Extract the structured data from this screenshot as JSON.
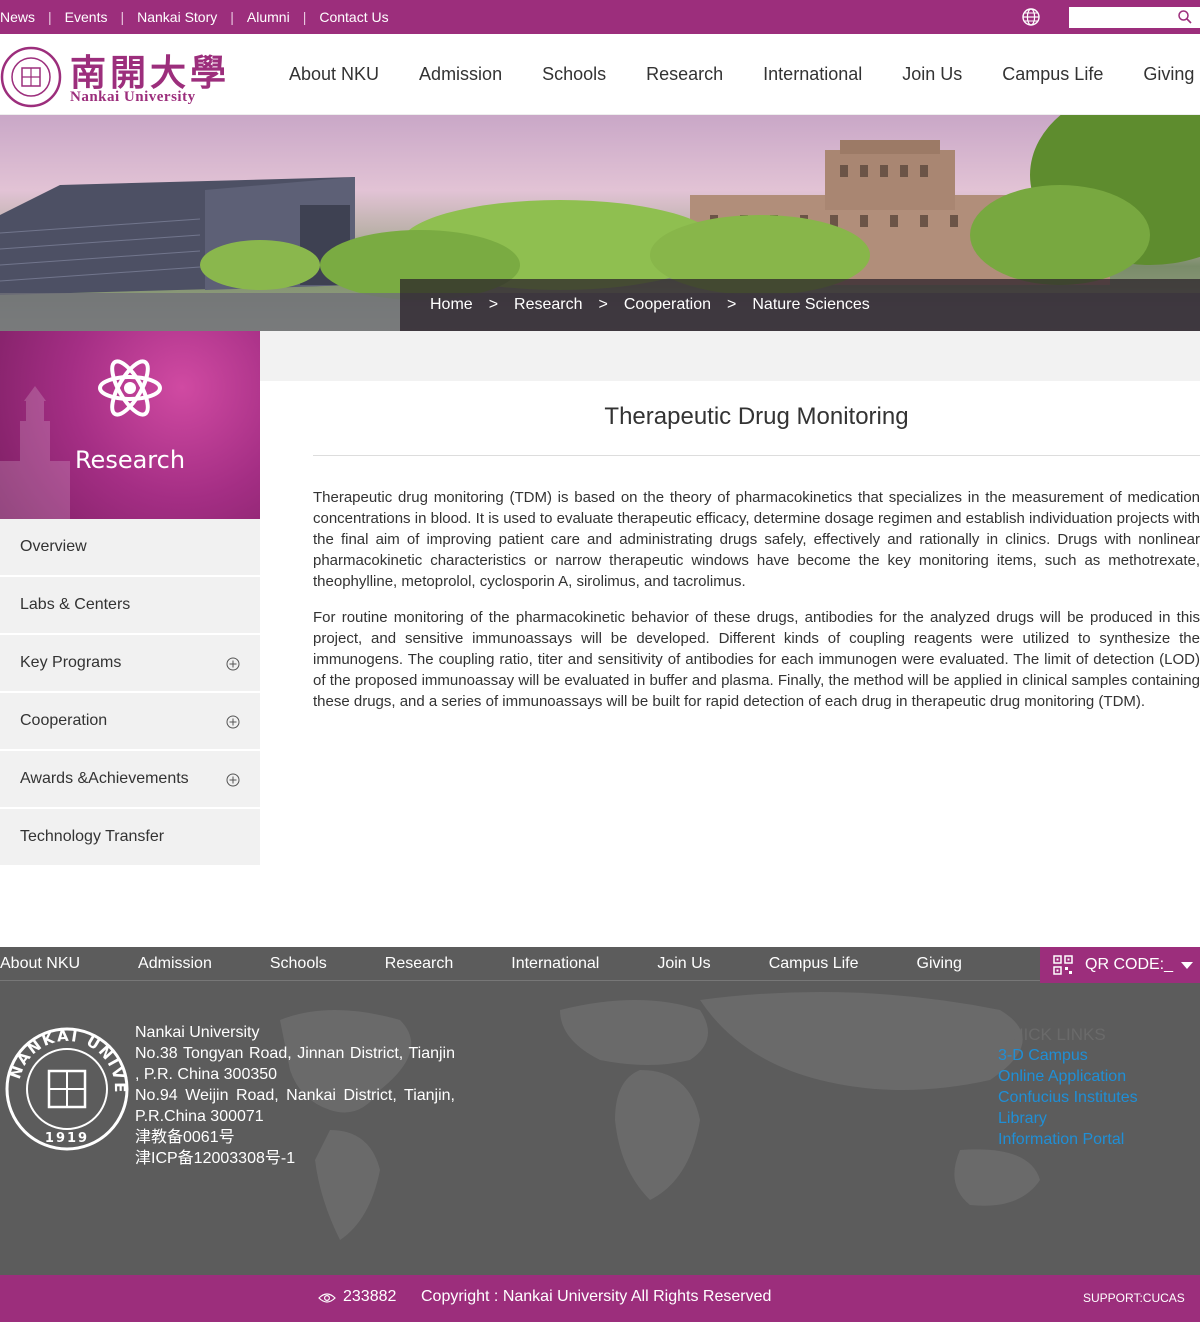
{
  "topbar": {
    "links": [
      "News",
      "Events",
      "Nankai Story",
      "Alumni",
      "Contact Us"
    ],
    "search_placeholder": ""
  },
  "header": {
    "logo_cn": "南開大學",
    "logo_en": "Nankai University",
    "nav": [
      "About NKU",
      "Admission",
      "Schools",
      "Research",
      "International",
      "Join Us",
      "Campus Life",
      "Giving"
    ]
  },
  "breadcrumb": {
    "items": [
      "Home",
      "Research",
      "Cooperation",
      "Nature Sciences"
    ],
    "separator": ">"
  },
  "sidebar": {
    "title": "Research",
    "items": [
      {
        "label": "Overview",
        "expandable": false
      },
      {
        "label": "Labs & Centers",
        "expandable": false
      },
      {
        "label": "Key Programs",
        "expandable": true
      },
      {
        "label": "Cooperation",
        "expandable": true
      },
      {
        "label": "Awards &Achievements",
        "expandable": true
      },
      {
        "label": "Technology Transfer",
        "expandable": false
      }
    ]
  },
  "article": {
    "title": "Therapeutic Drug Monitoring",
    "paragraphs": [
      "Therapeutic drug monitoring (TDM) is based on the theory of pharmacokinetics that specializes in the measurement of medication concentrations in blood. It is used to evaluate therapeutic efficacy, determine dosage regimen and establish individuation projects with the final aim of improving patient care and administrating drugs safely, effectively and rationally in clinics. Drugs with nonlinear pharmacokinetic characteristics or narrow therapeutic windows have become the key monitoring items, such as methotrexate, theophylline, metoprolol, cyclosporin A, sirolimus, and tacrolimus.",
      "For routine monitoring of the pharmacokinetic behavior of these drugs, antibodies for the analyzed drugs will be produced in this project, and sensitive immunoassays will be developed. Different kinds of coupling reagents were utilized to synthesize the immunogens. The coupling ratio, titer and sensitivity of antibodies for each immunogen were evaluated. The limit of detection (LOD) of the proposed immunoassay will be evaluated in buffer and plasma. Finally, the method will be applied in clinical samples containing these drugs, and a series of immunoassays will be built for rapid detection of each drug in therapeutic drug monitoring (TDM)."
    ]
  },
  "footer": {
    "nav": [
      "About NKU",
      "Admission",
      "Schools",
      "Research",
      "International",
      "Join Us",
      "Campus Life",
      "Giving"
    ],
    "qr_label": "QR CODE:_",
    "address_lines": [
      "Nankai University",
      "No.38 Tongyan Road, Jinnan District, Tianjin , P.R. China 300350",
      "No.94 Weijin Road,  Nankai District, Tianjin, P.R.China  300071",
      "津教备0061号",
      "津ICP备12003308号-1"
    ],
    "quick_links_title": "QUICK LINKS",
    "quick_links": [
      "3-D Campus",
      "Online Application",
      "Confucius Institutes",
      "Library",
      "Information Portal"
    ],
    "visits": "233882",
    "copyright": "Copyright : Nankai University All Rights Reserved",
    "support": "SUPPORT:CUCAS"
  },
  "colors": {
    "brand": "#9c2e7c",
    "link": "#1f8fd6",
    "footer_bg": "#5c5c5c"
  },
  "icons": {
    "globe": "globe-icon",
    "search": "search-icon",
    "atom": "atom-icon",
    "plus": "plus-circle-icon",
    "qr": "qr-code-icon",
    "eye": "eye-icon"
  }
}
